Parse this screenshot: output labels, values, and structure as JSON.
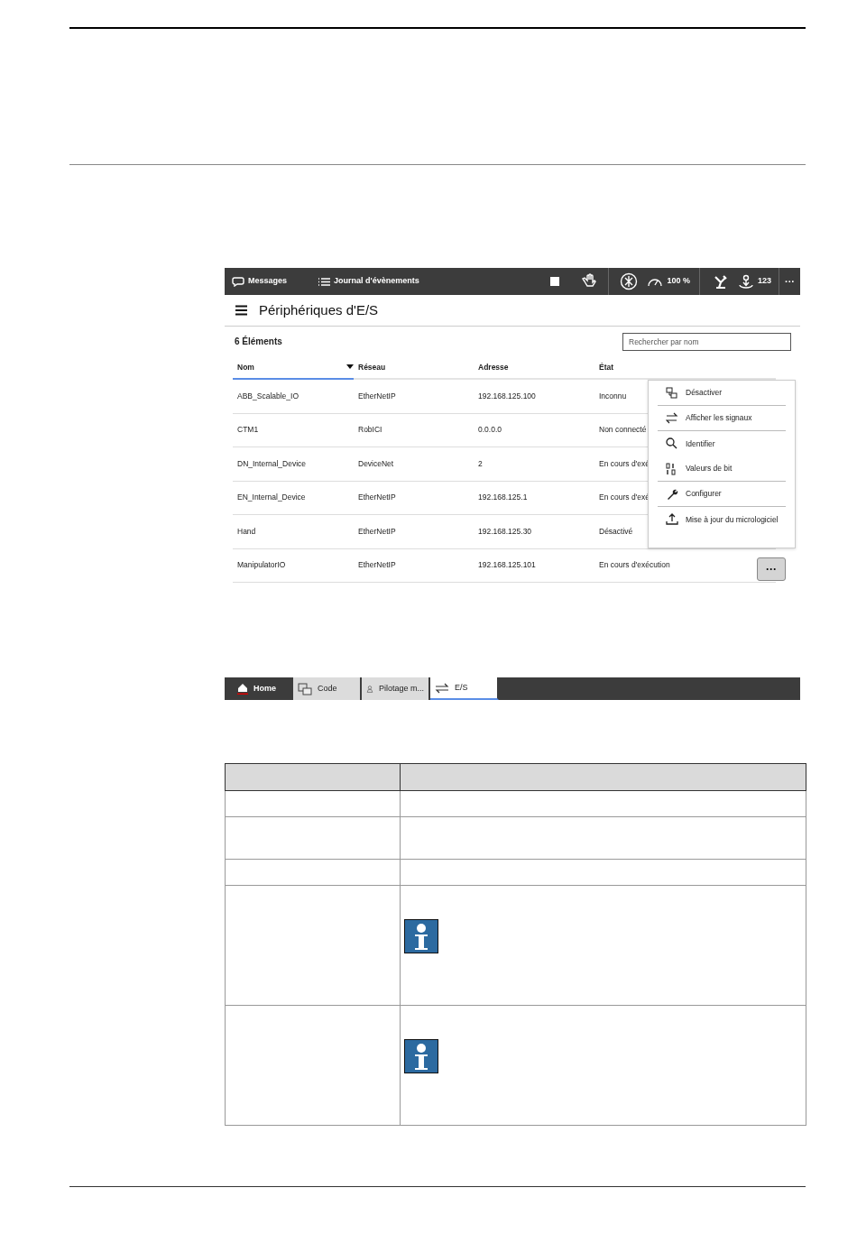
{
  "toolbar": {
    "messages": "Messages",
    "event_log": "Journal d'évènements",
    "speed": "100 %",
    "increment": "123",
    "more": "···"
  },
  "header": {
    "title": "Périphériques d'E/S",
    "count": "6 Éléments",
    "search": {
      "placeholder": "Rechercher par nom"
    }
  },
  "table": {
    "columns": [
      {
        "label": "Nom",
        "sorted": true
      },
      {
        "label": "Réseau",
        "sorted": false
      },
      {
        "label": "Adresse",
        "sorted": false
      },
      {
        "label": "État",
        "sorted": false
      }
    ],
    "rows": [
      {
        "cells": [
          "ABB_Scalable_IO",
          "EtherNetIP",
          "192.168.125.100",
          "Inconnu"
        ]
      },
      {
        "cells": [
          "CTM1",
          "RobICI",
          "0.0.0.0",
          "Non connecté"
        ]
      },
      {
        "cells": [
          "DN_Internal_Device",
          "DeviceNet",
          "2",
          "En cours d'exé"
        ]
      },
      {
        "cells": [
          "EN_Internal_Device",
          "EtherNetIP",
          "192.168.125.1",
          "En cours d'exé"
        ]
      },
      {
        "cells": [
          "Hand",
          "EtherNetIP",
          "192.168.125.30",
          "Désactivé"
        ]
      },
      {
        "cells": [
          "ManipulatorIO",
          "EtherNetIP",
          "192.168.125.101",
          "En cours d'exécution"
        ],
        "more": "···"
      }
    ]
  },
  "context_menu": [
    {
      "label": "Désactiver",
      "divider_after": true
    },
    {
      "label": "Afficher les signaux",
      "divider_after": true
    },
    {
      "label": "Identifier",
      "divider_after": false
    },
    {
      "label": "Valeurs de bit",
      "divider_after": true
    },
    {
      "label": "Configurer",
      "divider_after": true
    },
    {
      "label": "Mise à jour du micrologiciel",
      "divider_after": false
    }
  ],
  "taskbar": [
    {
      "kind": "home",
      "label": "Home",
      "selected": false
    },
    {
      "kind": "app",
      "label": "Code",
      "selected": false
    },
    {
      "kind": "app",
      "label": "Pilotage m...",
      "selected": false
    },
    {
      "kind": "app",
      "label": "E/S",
      "selected": true
    }
  ],
  "doc_table": {
    "rows": [
      {
        "kind": "plain"
      },
      {
        "kind": "tall"
      },
      {
        "kind": "plain"
      },
      {
        "kind": "note"
      },
      {
        "kind": "note"
      }
    ]
  }
}
